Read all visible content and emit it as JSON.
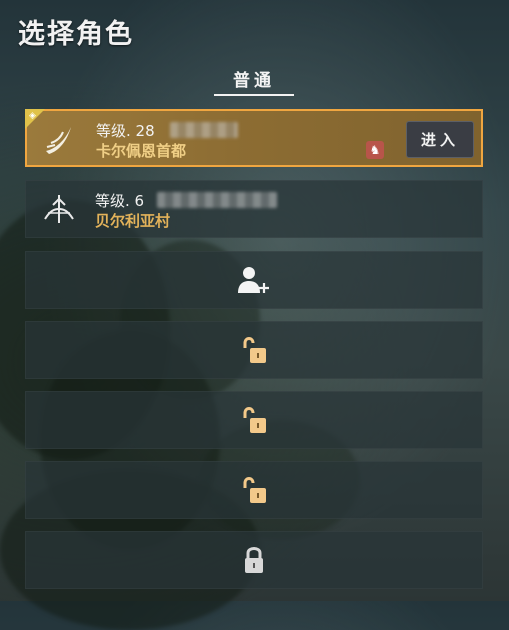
{
  "page": {
    "title": "选择角色"
  },
  "tabs": [
    {
      "label": "普通",
      "active": true
    }
  ],
  "characters": [
    {
      "level_text": "等级. 28",
      "location": "卡尔佩恩首都",
      "enter_label": "进入",
      "selected": true,
      "class_icon": "crescent-blade-icon",
      "mount_icon": "horse-icon"
    },
    {
      "level_text": "等级. 6",
      "location": "贝尔利亚村",
      "selected": false,
      "class_icon": "crossbow-icon"
    }
  ],
  "empty_slots": [
    {
      "icon": "add-character-icon"
    },
    {
      "icon": "unlocked-padlock-icon"
    },
    {
      "icon": "unlocked-padlock-icon"
    },
    {
      "icon": "unlocked-padlock-icon"
    },
    {
      "icon": "locked-padlock-icon"
    }
  ],
  "colors": {
    "accent": "#f0a640",
    "location_text": "#e2b25a",
    "lock_glow": "#f3c98a"
  }
}
